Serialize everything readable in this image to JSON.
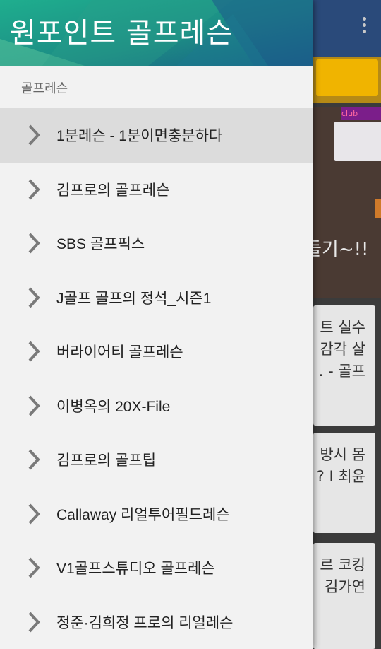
{
  "app": {
    "title": "원포인트 골프레슨"
  },
  "drawer": {
    "section_label": "골프레슨",
    "items": [
      {
        "label": "1분레슨 - 1분이면충분하다",
        "selected": true
      },
      {
        "label": "김프로의 골프레슨",
        "selected": false
      },
      {
        "label": "SBS 골프픽스",
        "selected": false
      },
      {
        "label": "J골프 골프의 정석_시즌1",
        "selected": false
      },
      {
        "label": "버라이어티 골프레슨",
        "selected": false
      },
      {
        "label": "이병옥의 20X-File",
        "selected": false
      },
      {
        "label": "김프로의 골프팁",
        "selected": false
      },
      {
        "label": "Callaway 리얼투어필드레슨",
        "selected": false
      },
      {
        "label": "V1골프스튜디오 골프레슨",
        "selected": false
      },
      {
        "label": "정준·김희정 프로의 리얼레슨",
        "selected": false
      }
    ]
  },
  "background": {
    "photo_board_text": "club",
    "photo_overlay": "들기~!!",
    "cards": [
      {
        "lines": [
          "트 실수",
          "감각 살",
          ". - 골프"
        ]
      },
      {
        "lines": [
          "방시 몸",
          "? I 최윤"
        ]
      },
      {
        "lines": [
          "르 코킹",
          "김가연"
        ]
      }
    ]
  },
  "icons": {
    "more": "more-vert-icon",
    "chevron": "chevron-right-icon"
  },
  "colors": {
    "toolbar": "#2a4a7a",
    "drawer_bg": "#f2f2f2",
    "selected_bg": "#dcdcdc",
    "header_teal": "#1a8a7a"
  }
}
